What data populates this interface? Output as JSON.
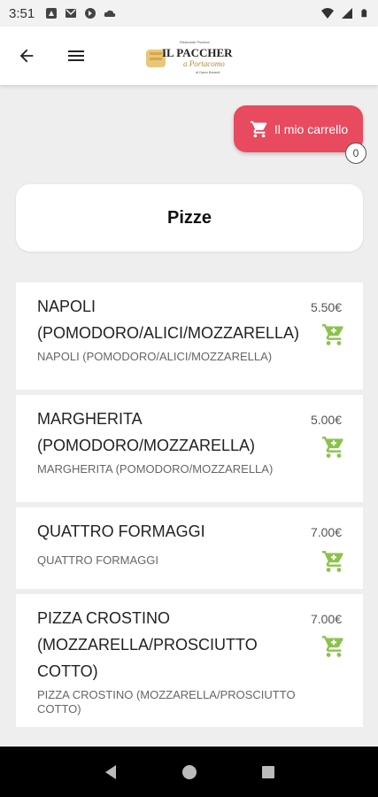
{
  "status_bar": {
    "time": "3:51"
  },
  "app_bar": {
    "logo_title": "IL PACCHERO",
    "logo_subtitle": "a Portacomo",
    "logo_small": "di Dario Benedi",
    "logo_top": "Ristorante Pizzeria"
  },
  "cart": {
    "label": "Il mio carrello",
    "count": "0"
  },
  "category": {
    "title": "Pizze"
  },
  "products": [
    {
      "name": "NAPOLI (POMODORO/ALICI/MOZZARELLA)",
      "price": "5.50€",
      "description": "NAPOLI (POMODORO/ALICI/MOZZARELLA)"
    },
    {
      "name": "MARGHERITA (POMODORO/MOZZARELLA)",
      "price": "5.00€",
      "description": "MARGHERITA (POMODORO/MOZZARELLA)"
    },
    {
      "name": "QUATTRO FORMAGGI",
      "price": "7.00€",
      "description": "QUATTRO FORMAGGI"
    },
    {
      "name": "PIZZA CROSTINO (MOZZARELLA/PROSCIUTTO COTTO)",
      "price": "7.00€",
      "description": "PIZZA CROSTINO (MOZZARELLA/PROSCIUTTO COTTO)"
    }
  ],
  "colors": {
    "accent": "#e84a5f",
    "add_icon": "#8bc34a",
    "background": "#eeeeee"
  }
}
